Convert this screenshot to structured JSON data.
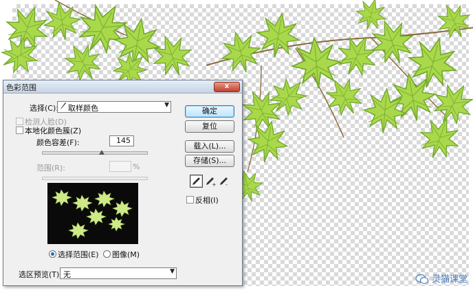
{
  "dialog": {
    "title": "色彩范围",
    "close_label": "x",
    "select_label": "选择(C):",
    "select_value": "取样颜色",
    "detect_faces_label": "检测人脸(D)",
    "localized_clusters_label": "本地化颜色簇(Z)",
    "fuzziness_label": "颜色容差(F):",
    "fuzziness_value": "145",
    "fuzziness_level": 0.57,
    "range_label": "范围(R):",
    "range_unit": "%",
    "radio_selection_label": "选择范围(E)",
    "radio_image_label": "图像(M)",
    "selection_preview_label": "选区预览(T):",
    "selection_preview_value": "无",
    "invert_label": "反相(I)"
  },
  "buttons": {
    "ok": "确定",
    "reset": "复位",
    "load": "载入(L)...",
    "save": "存储(S)..."
  },
  "icons": {
    "eyedropper": "eyedropper-icon",
    "eyedropper_add": "eyedropper-plus-icon",
    "eyedropper_subtract": "eyedropper-minus-icon",
    "wechat": "wechat-icon"
  },
  "watermark": {
    "text": "灵猫课堂"
  },
  "colors": {
    "leaf": "#a7d84a",
    "leaf_dark": "#5f9a1e",
    "accent": "#3c7fb1"
  }
}
